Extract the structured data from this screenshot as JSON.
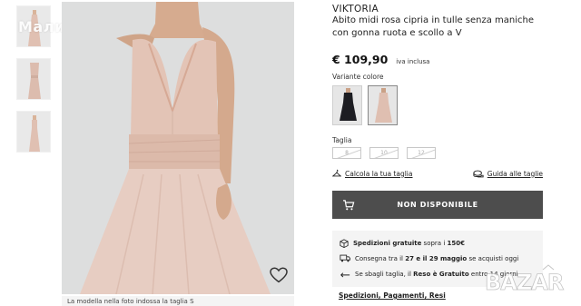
{
  "watermark": "Мали",
  "gallery": {
    "thumbnails": [
      "dress-front",
      "dress-front-close",
      "dress-side"
    ],
    "caption": "La modella nella foto indossa la taglia S"
  },
  "product": {
    "brand": "VIKTORIA",
    "title": "Abito midi rosa cipria in tulle senza maniche con gonna ruota e scollo a V",
    "price": "€ 109,90",
    "vat_note": "iva inclusa",
    "variant_label": "Variante colore",
    "variants": [
      "black",
      "powder-pink"
    ],
    "size_label": "Taglia",
    "sizes": [
      "8",
      "10",
      "12"
    ],
    "fit_link": "Calcola la tua taglia",
    "guide_link": "Guida alle taglie",
    "cta": "NON DISPONIBILE"
  },
  "info": {
    "shipping_bold": "Spedizioni gratuite",
    "shipping_rest": " sopra i ",
    "shipping_amount": "150€",
    "delivery_pre": "Consegna tra il ",
    "delivery_dates": "27 e il 29 maggio",
    "delivery_post": " se acquisti oggi",
    "returns_pre": "Se sbagli taglia, il ",
    "returns_bold": "Reso è Gratuito",
    "returns_post": " entro 14 giorni",
    "link": "Spedizioni, Pagamenti, Resi"
  },
  "logo_text": "BAZAR",
  "colors": {
    "cta_bg": "#4d4d4d",
    "dress": "#e2c3b6",
    "info_bg": "#f4f4f4"
  }
}
